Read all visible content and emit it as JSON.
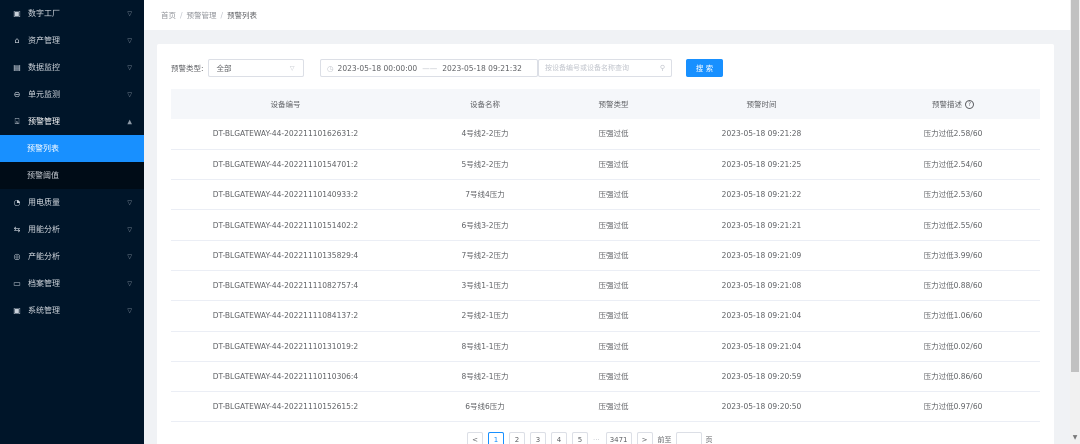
{
  "sidebar": {
    "items": [
      {
        "label": "数字工厂",
        "icon": "▣"
      },
      {
        "label": "资产管理",
        "icon": "⌂"
      },
      {
        "label": "数据监控",
        "icon": "▤"
      },
      {
        "label": "单元监测",
        "icon": "⊖"
      },
      {
        "label": "预警管理",
        "icon": "⌺"
      },
      {
        "label": "用电质量",
        "icon": "◔"
      },
      {
        "label": "用能分析",
        "icon": "⇆"
      },
      {
        "label": "产能分析",
        "icon": "◎"
      },
      {
        "label": "档案管理",
        "icon": "▭"
      },
      {
        "label": "系统管理",
        "icon": "▣"
      }
    ],
    "sub_items": [
      "预警列表",
      "预警阈值"
    ]
  },
  "breadcrumb": [
    "首页",
    "预警管理",
    "预警列表"
  ],
  "filter": {
    "type_label": "预警类型:",
    "type_value": "全部",
    "date_start": "2023-05-18 00:00:00",
    "date_end": "2023-05-18 09:21:32",
    "search_placeholder": "按设备编号或设备名称查询",
    "search_button": "搜 索"
  },
  "table": {
    "headers": [
      "设备编号",
      "设备名称",
      "预警类型",
      "预警时间",
      "预警描述"
    ],
    "rows": [
      [
        "DT-BLGATEWAY-44-20221110162631:2",
        "4号线2-2压力",
        "压强过低",
        "2023-05-18 09:21:28",
        "压力过低2.58/60"
      ],
      [
        "DT-BLGATEWAY-44-20221110154701:2",
        "5号线2-2压力",
        "压强过低",
        "2023-05-18 09:21:25",
        "压力过低2.54/60"
      ],
      [
        "DT-BLGATEWAY-44-20221110140933:2",
        "7号线4压力",
        "压强过低",
        "2023-05-18 09:21:22",
        "压力过低2.53/60"
      ],
      [
        "DT-BLGATEWAY-44-20221110151402:2",
        "6号线3-2压力",
        "压强过低",
        "2023-05-18 09:21:21",
        "压力过低2.55/60"
      ],
      [
        "DT-BLGATEWAY-44-20221110135829:4",
        "7号线2-2压力",
        "压强过低",
        "2023-05-18 09:21:09",
        "压力过低3.99/60"
      ],
      [
        "DT-BLGATEWAY-44-20221111082757:4",
        "3号线1-1压力",
        "压强过低",
        "2023-05-18 09:21:08",
        "压力过低0.88/60"
      ],
      [
        "DT-BLGATEWAY-44-20221111084137:2",
        "2号线2-1压力",
        "压强过低",
        "2023-05-18 09:21:04",
        "压力过低1.06/60"
      ],
      [
        "DT-BLGATEWAY-44-20221110131019:2",
        "8号线1-1压力",
        "压强过低",
        "2023-05-18 09:21:04",
        "压力过低0.02/60"
      ],
      [
        "DT-BLGATEWAY-44-20221110110306:4",
        "8号线2-1压力",
        "压强过低",
        "2023-05-18 09:20:59",
        "压力过低0.86/60"
      ],
      [
        "DT-BLGATEWAY-44-20221110152615:2",
        "6号线6压力",
        "压强过低",
        "2023-05-18 09:20:50",
        "压力过低0.97/60"
      ]
    ]
  },
  "pagination": {
    "prev": "<",
    "pages": [
      "1",
      "2",
      "3",
      "4",
      "5"
    ],
    "dots": "···",
    "last": "3471",
    "next": ">",
    "goto_label": "前至",
    "page_unit": "页"
  },
  "colors": {
    "sidebar_bg": "#001529",
    "accent": "#1890ff"
  }
}
